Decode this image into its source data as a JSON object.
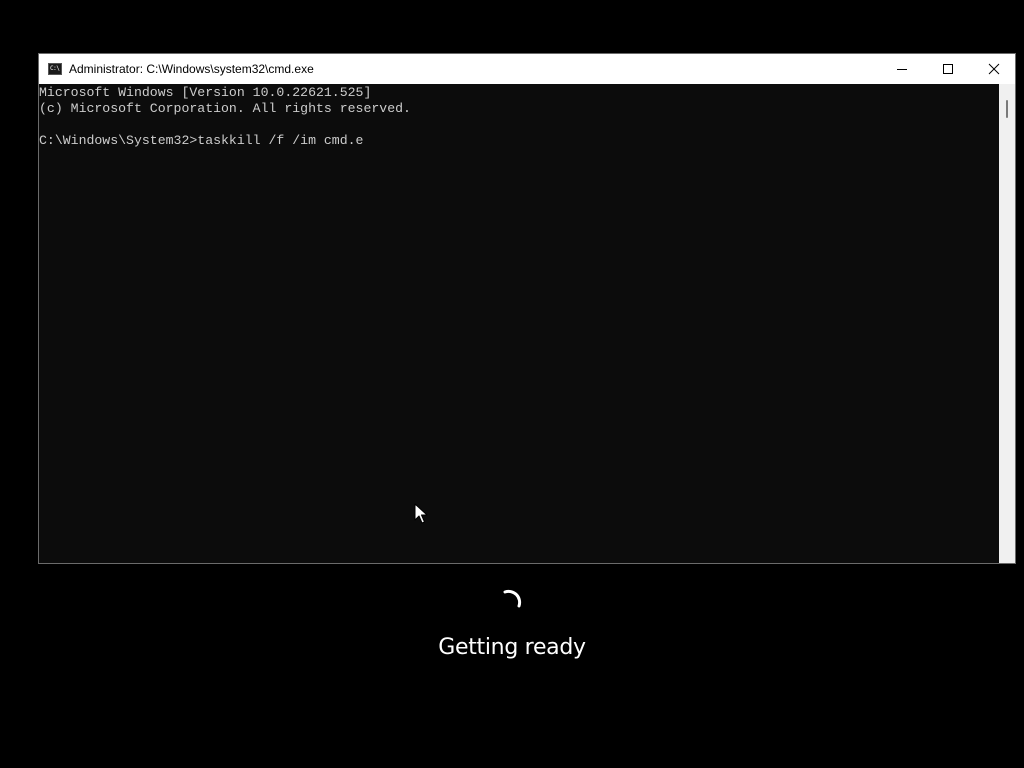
{
  "window": {
    "title": "Administrator: C:\\Windows\\system32\\cmd.exe",
    "app_icon": "command-prompt-icon",
    "app_icon_glyph": "C:\\",
    "controls": [
      "minimize-icon",
      "maximize-icon",
      "close-icon"
    ]
  },
  "console": {
    "lines": [
      "Microsoft Windows [Version 10.0.22621.525]",
      "(c) Microsoft Corporation. All rights reserved.",
      "C:\\Windows\\System32>taskkill /f /im cmd.e"
    ]
  },
  "overlay": {
    "spinner_icon": "loading-spinner-icon",
    "status": "Getting ready"
  },
  "colors": {
    "screen_background": "#000000",
    "console_background": "#0c0c0c",
    "console_text": "#cccccc",
    "title_bar": "#ffffff",
    "status_text": "#ffffff"
  }
}
